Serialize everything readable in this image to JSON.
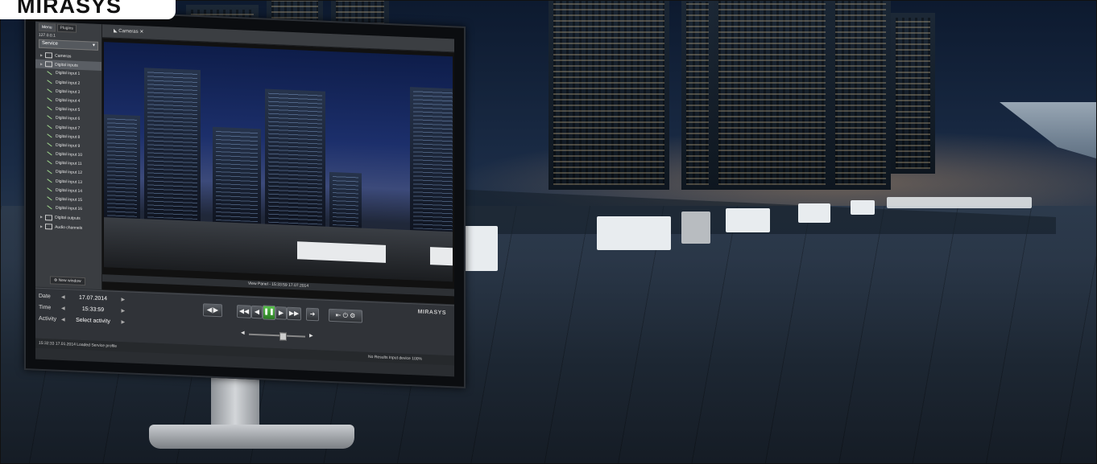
{
  "brand": {
    "name": "MIRASYS"
  },
  "app": {
    "tabs": [
      "Menu",
      "Plugins"
    ],
    "ip": "127.0.0.1",
    "service_select": "Service",
    "tree": {
      "cameras": "Cameras",
      "digital_inputs": "Digital inputs",
      "inputs": [
        "Digital input 1",
        "Digital input 2",
        "Digital input 3",
        "Digital input 4",
        "Digital input 5",
        "Digital input 6",
        "Digital input 7",
        "Digital input 8",
        "Digital input 9",
        "Digital input 10",
        "Digital input 11",
        "Digital input 12",
        "Digital input 13",
        "Digital input 14",
        "Digital input 15",
        "Digital input 16"
      ],
      "digital_outputs": "Digital outputs",
      "audio_channels": "Audio channels"
    },
    "new_window": "New window",
    "video_tab": "Cameras",
    "view_panel": "View Panel - 15:33:59 17.07.2014",
    "date_label": "Date",
    "date_value": "17.07.2014",
    "time_label": "Time",
    "time_value": "15:33:59",
    "activity_label": "Activity",
    "activity_value": "Select activity",
    "logo": "MIRASYS",
    "status_text": "15:32:33  17.01.2014 Loaded Service profile",
    "status_right": "No Results    Input device    100%"
  }
}
